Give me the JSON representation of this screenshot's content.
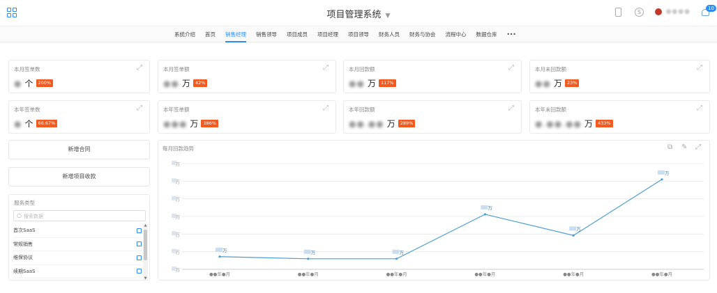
{
  "header": {
    "title": "项目管理系统",
    "notification_count": "10",
    "user_name": "●●●●"
  },
  "nav": {
    "tabs": [
      "系统介绍",
      "首页",
      "销售经理",
      "销售领导",
      "项目成员",
      "项目经理",
      "项目领导",
      "财务人员",
      "财务与协会",
      "流程中心",
      "数据仓库",
      "•••"
    ],
    "active_index": 2
  },
  "stats_month": [
    {
      "label": "本月签单数",
      "value": "●",
      "unit": "个",
      "pct": "200%"
    },
    {
      "label": "本月签单额",
      "value": "●●",
      "unit": "万",
      "pct": "42%"
    },
    {
      "label": "本月回款额",
      "value": "●●",
      "unit": "万",
      "pct": "117%"
    },
    {
      "label": "本月未回款额",
      "value": "●●",
      "unit": "万",
      "pct": "23%"
    }
  ],
  "stats_year": [
    {
      "label": "本年签单数",
      "value": "●",
      "unit": "个",
      "pct": "66.67%"
    },
    {
      "label": "本年签单额",
      "value": "●●●",
      "unit": "万",
      "pct": "386%"
    },
    {
      "label": "本年回款额",
      "value": "●●.●●",
      "unit": "万",
      "pct": "289%"
    },
    {
      "label": "本年未回款额",
      "value": "●.●●.●●",
      "unit": "万",
      "pct": "433%"
    }
  ],
  "actions": {
    "new_contract": "新增合同",
    "new_payment": "新增项目收款"
  },
  "services": {
    "title": "服务类型",
    "search_placeholder": "搜索数据",
    "items": [
      "首次SaaS",
      "常规销售",
      "维保协议",
      "续期SaaS"
    ]
  },
  "chart": {
    "title": "每月回款趋势",
    "point_label_unit": "万",
    "y_tick_unit": "万",
    "x_tick_suffix": "年●月"
  },
  "colors": {
    "accent": "#2d8cf0",
    "badge": "#f25a1f",
    "line": "#4a9fd1"
  },
  "chart_data": {
    "type": "line",
    "title": "每月回款趋势",
    "categories": [
      "●●年●月",
      "●●年●月",
      "●●年●月",
      "●●年●月",
      "●●年●月",
      "●●年●月"
    ],
    "values": [
      12,
      10,
      10,
      52,
      32,
      85
    ],
    "ylim": [
      0,
      100
    ],
    "grid": true
  }
}
